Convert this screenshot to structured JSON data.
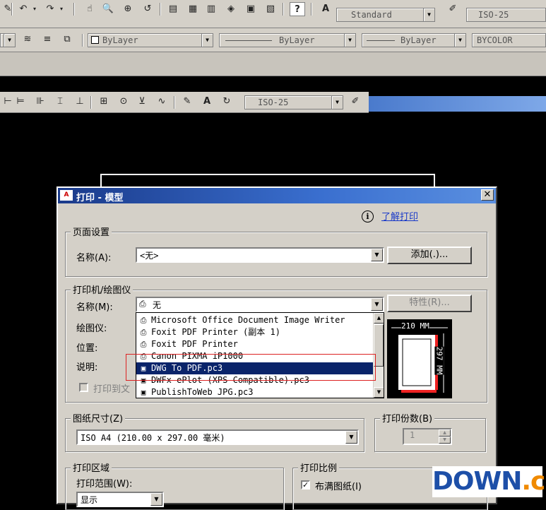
{
  "toolbar_top": {
    "text_style": "Standard",
    "dim_style": "ISO-25"
  },
  "toolbar_props": {
    "layer": "ByLayer",
    "linetype": "ByLayer",
    "lineweight": "ByLayer",
    "plot_style": "BYCOLOR"
  },
  "toolbar_dim": {
    "dim_style": "ISO-25"
  },
  "dialog": {
    "title": "打印 - 模型",
    "app_icon": "A",
    "help_link": "了解打印",
    "page_setup": {
      "group_title": "页面设置",
      "name_label": "名称(A):",
      "name_value": "<无>",
      "add_button": "添加(.)..."
    },
    "printer": {
      "group_title": "打印机/绘图仪",
      "name_label": "名称(M):",
      "name_value": "无",
      "properties_button": "特性(R)...",
      "plotter_label": "绘图仪:",
      "location_label": "位置:",
      "description_label": "说明:",
      "print_to_file_label": "打印到文",
      "options": [
        "Microsoft Office Document Image Writer",
        "Foxit PDF Printer (副本 1)",
        "Foxit PDF Printer",
        "Canon PIXMA iP1000",
        "DWG To PDF.pc3",
        "DWFx ePlot (XPS Compatible).pc3",
        "PublishToWeb JPG.pc3"
      ],
      "selected_index": 4,
      "preview_width": "210 MM",
      "preview_height": "297 MM"
    },
    "paper_size": {
      "group_title": "图纸尺寸(Z)",
      "value": "ISO A4 (210.00 x 297.00 毫米)"
    },
    "copies": {
      "group_title": "打印份数(B)",
      "value": "1"
    },
    "plot_area": {
      "group_title": "打印区域",
      "range_label": "打印范围(W):",
      "range_value": "显示"
    },
    "plot_scale": {
      "group_title": "打印比例",
      "fit_paper_label": "布满图纸(I)",
      "fit_paper_checked": true
    }
  },
  "watermark": {
    "text_a": "DOWN",
    "text_b": ".cc"
  },
  "colors": {
    "title_bar": "#1a3a8a",
    "selection": "#0a246a",
    "highlight_box": "#dd2222",
    "watermark_blue": "#1d4fa8",
    "watermark_orange": "#f08a00"
  }
}
